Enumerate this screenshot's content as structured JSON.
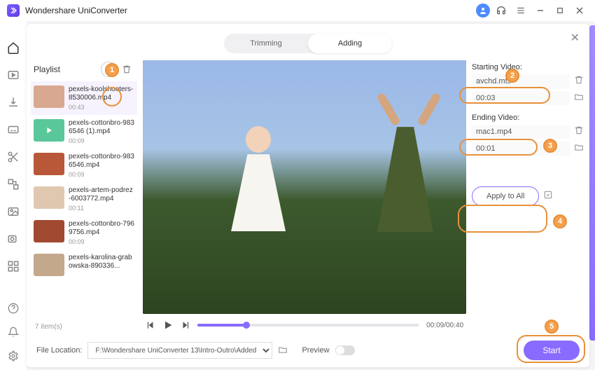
{
  "app": {
    "title": "Wondershare UniConverter"
  },
  "tabs": {
    "trimming": "Trimming",
    "adding": "Adding"
  },
  "playlist": {
    "title": "Playlist",
    "count_text": "7 item(s)",
    "items": [
      {
        "name": "pexels-koolshooters-8530006.mp4",
        "dur": "00:43",
        "thumb": "#d9a890",
        "selected": true
      },
      {
        "name": "pexels-cottonbro-9836546 (1).mp4",
        "dur": "00:09",
        "thumb": "#5ac79a",
        "placeholder": true
      },
      {
        "name": "pexels-cottonbro-9836546.mp4",
        "dur": "00:09",
        "thumb": "#b85838"
      },
      {
        "name": "pexels-artem-podrez-6003772.mp4",
        "dur": "00:11",
        "thumb": "#e0c8b0"
      },
      {
        "name": "pexels-cottonbro-7969756.mp4",
        "dur": "00:09",
        "thumb": "#a04830"
      },
      {
        "name": "pexels-karolina-grabowska-890336...",
        "dur": "",
        "thumb": "#c4a88c"
      }
    ]
  },
  "preview": {
    "time": "00:09/00:40"
  },
  "side": {
    "starting_label": "Starting Video:",
    "starting_file": "avchd.mts",
    "starting_dur": "00:03",
    "ending_label": "Ending Video:",
    "ending_file": "mac1.mp4",
    "ending_dur": "00:01",
    "apply_label": "Apply to All"
  },
  "bottom": {
    "loc_label": "File Location:",
    "loc_path": "F:\\Wondershare UniConverter 13\\Intro-Outro\\Added",
    "preview_label": "Preview",
    "start_label": "Start"
  },
  "callouts": {
    "c1": "1",
    "c2": "2",
    "c3": "3",
    "c4": "4",
    "c5": "5"
  }
}
